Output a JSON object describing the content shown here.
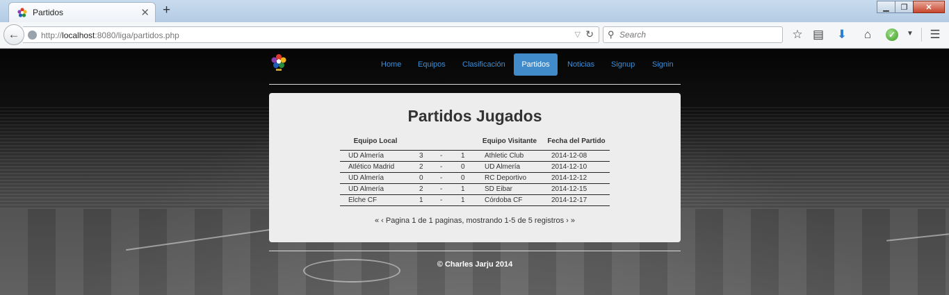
{
  "browser": {
    "tab_title": "Partidos",
    "url_prefix": "http://",
    "url_host": "localhost",
    "url_rest": ":8080/liga/partidos.php",
    "search_placeholder": "Search",
    "icons": [
      "back-icon",
      "globe-icon",
      "reload-icon",
      "search-icon",
      "bookmark-star-icon",
      "reading-list-icon",
      "download-icon",
      "home-icon",
      "addon-check-icon",
      "menu-icon"
    ]
  },
  "nav": {
    "items": [
      {
        "label": "Home",
        "active": false
      },
      {
        "label": "Equipos",
        "active": false
      },
      {
        "label": "Clasificación",
        "active": false
      },
      {
        "label": "Partidos",
        "active": true
      },
      {
        "label": "Noticias",
        "active": false
      },
      {
        "label": "Signup",
        "active": false
      },
      {
        "label": "Signin",
        "active": false
      }
    ],
    "accent": "#428bca"
  },
  "main": {
    "title": "Partidos Jugados",
    "columns": [
      "Equipo Local",
      "Equipo Visitante",
      "Fecha del Partido"
    ],
    "rows": [
      {
        "local": "UD Almería",
        "goles_local": "3",
        "sep": "-",
        "goles_visitante": "1",
        "visitante": "Athletic Club",
        "fecha": "2014-12-08"
      },
      {
        "local": "Atlético Madrid",
        "goles_local": "2",
        "sep": "-",
        "goles_visitante": "0",
        "visitante": "UD Almería",
        "fecha": "2014-12-10"
      },
      {
        "local": "UD Almería",
        "goles_local": "0",
        "sep": "-",
        "goles_visitante": "0",
        "visitante": "RC Deportivo",
        "fecha": "2014-12-12"
      },
      {
        "local": "UD Almería",
        "goles_local": "2",
        "sep": "-",
        "goles_visitante": "1",
        "visitante": "SD Eibar",
        "fecha": "2014-12-15"
      },
      {
        "local": "Elche CF",
        "goles_local": "1",
        "sep": "-",
        "goles_visitante": "1",
        "visitante": "Córdoba CF",
        "fecha": "2014-12-17"
      }
    ],
    "pager": {
      "first": "«",
      "prev": "‹",
      "text": "Pagina 1 de 1 paginas, mostrando 1-5 de 5 registros",
      "next": "›",
      "last": "»"
    }
  },
  "footer": {
    "text": "© Charles Jarju 2014"
  }
}
